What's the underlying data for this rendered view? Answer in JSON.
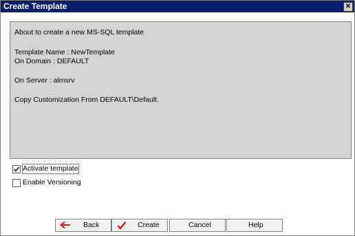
{
  "dialog": {
    "title": "Create Template",
    "close_glyph": "✕"
  },
  "summary": {
    "line1": "About to create a new MS-SQL template",
    "line2": "Template Name : NewTemplate",
    "line3": "On Domain : DEFAULT",
    "line4": "On Server : almsrv",
    "line5": "Copy Customization From DEFAULT\\Default."
  },
  "options": {
    "activate_label": "Activate template",
    "activate_checked": true,
    "versioning_label": "Enable Versioning",
    "versioning_checked": false
  },
  "buttons": {
    "back_label": "Back",
    "back_icon": "arrow-left-icon",
    "create_label": "Create",
    "create_icon": "checkmark-icon",
    "cancel_label": "Cancel",
    "help_label": "Help"
  },
  "colors": {
    "titlebar": "#0a1e6e",
    "summary_bg": "#d4d4d4",
    "back_arrow": "#d01010",
    "create_check": "#d01010"
  }
}
